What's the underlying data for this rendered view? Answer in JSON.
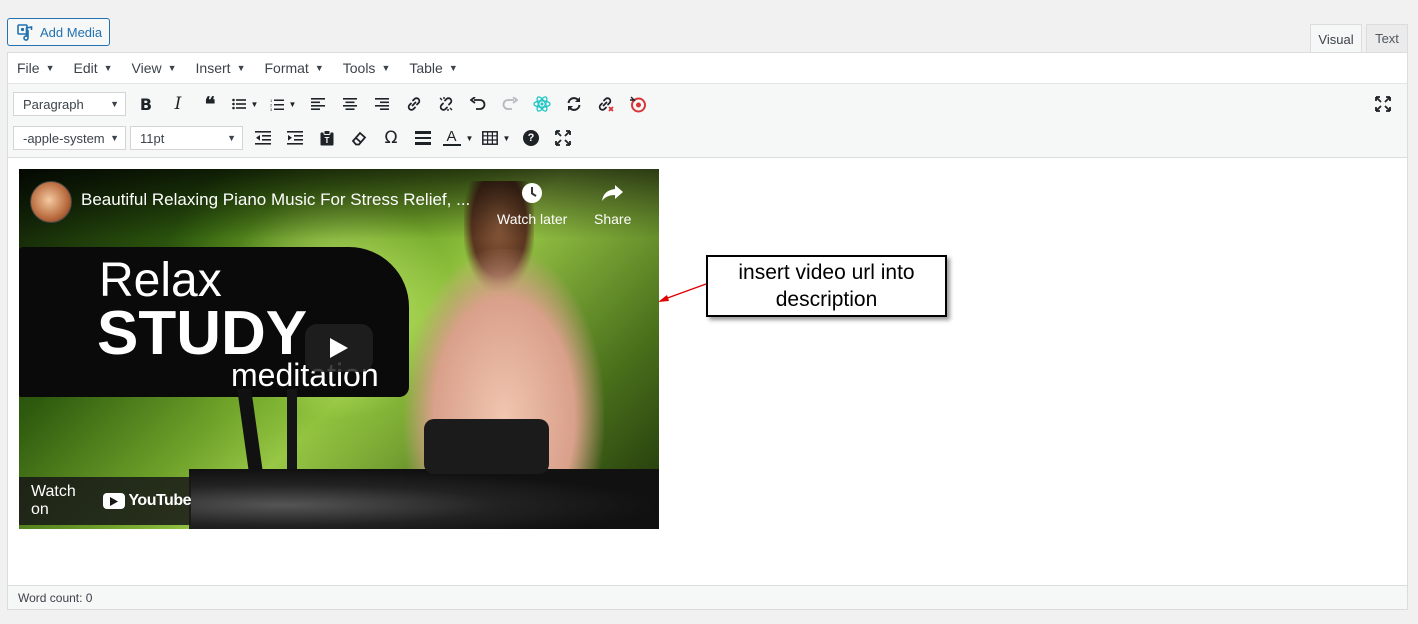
{
  "header": {
    "add_media_label": "Add Media",
    "tabs": [
      {
        "label": "Visual",
        "active": true
      },
      {
        "label": "Text",
        "active": false
      }
    ]
  },
  "menubar": {
    "items": [
      {
        "label": "File"
      },
      {
        "label": "Edit"
      },
      {
        "label": "View"
      },
      {
        "label": "Insert"
      },
      {
        "label": "Format"
      },
      {
        "label": "Tools"
      },
      {
        "label": "Table"
      }
    ]
  },
  "toolbar": {
    "block_format": "Paragraph",
    "font_family": "-apple-system",
    "font_size": "11pt",
    "icons_row1": [
      "bold-icon",
      "italic-icon",
      "blockquote-icon",
      "bullet-list-icon",
      "numbered-list-icon",
      "align-left-icon",
      "align-center-icon",
      "align-right-icon",
      "link-icon",
      "unlink-icon",
      "undo-icon",
      "redo-icon",
      "react-icon",
      "refresh-icon",
      "broken-link-icon",
      "help-target-icon",
      "fullscreen-icon"
    ],
    "icons_row2": [
      "outdent-icon",
      "indent-icon",
      "paste-text-icon",
      "clear-format-icon",
      "special-character-icon",
      "horizontal-rule-icon",
      "text-color-icon",
      "table-icon",
      "help-icon",
      "fullscreen-icon"
    ],
    "bold_glyph": "B",
    "italic_glyph": "I",
    "quote_glyph": "❝",
    "omega_glyph": "Ω",
    "text_color_glyph": "A",
    "help_glyph": "?"
  },
  "video": {
    "title": "Beautiful Relaxing Piano Music For Stress Relief, ...",
    "watch_later": "Watch later",
    "share": "Share",
    "overlay_line1": "Relax",
    "overlay_line2": "STUDY",
    "overlay_line3": "meditation",
    "watch_on": "Watch on",
    "youtube_word": "YouTube"
  },
  "annotation": {
    "callout_text": "insert video url into description",
    "arrow_color": "#e00000"
  },
  "status": {
    "word_count": "Word count: 0"
  },
  "colors": {
    "accent": "#2271b1",
    "teal_icon": "#1fc6c6",
    "red_icon": "#d63638"
  }
}
